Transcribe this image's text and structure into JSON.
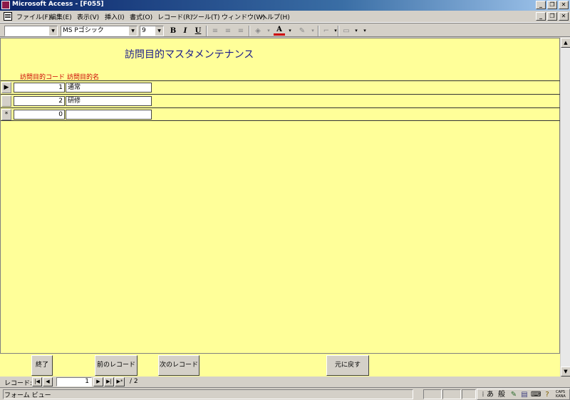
{
  "window": {
    "title": "Microsoft Access - [F055]"
  },
  "menu": {
    "items": [
      "ファイル(F)",
      "編集(E)",
      "表示(V)",
      "挿入(I)",
      "書式(O)",
      "レコード(R)",
      "ツール(T)",
      "ウィンドウ(W)",
      "ヘルプ(H)"
    ]
  },
  "toolbar": {
    "object_combo": "",
    "font_name": "MS Pゴシック",
    "font_size": "9",
    "bold": "B",
    "italic": "I",
    "underline": "U",
    "font_color_icon": "A"
  },
  "form": {
    "title": "訪問目的マスタメンテナンス",
    "col_code": "訪問目的コード",
    "col_name": "訪問目的名",
    "rows": [
      {
        "selector": "▶",
        "code": "1",
        "name": "通常"
      },
      {
        "selector": "",
        "code": "2",
        "name": "研修"
      },
      {
        "selector": "*",
        "code": "0",
        "name": ""
      }
    ]
  },
  "footer": {
    "exit": "終了",
    "prev": "前のレコード",
    "next": "次のレコード",
    "undo": "元に戻す"
  },
  "navigator": {
    "label": "レコード:",
    "current": "1",
    "total": "/ 2"
  },
  "status": {
    "text": "フォーム ビュー"
  },
  "ime": {
    "mode": "あ",
    "kanji": "般",
    "caps": "CAPS",
    "kana": "KANA"
  },
  "colors": {
    "form_background": "#ffff99",
    "title_color": "#1a1a8a",
    "header_color": "#cc0000"
  }
}
